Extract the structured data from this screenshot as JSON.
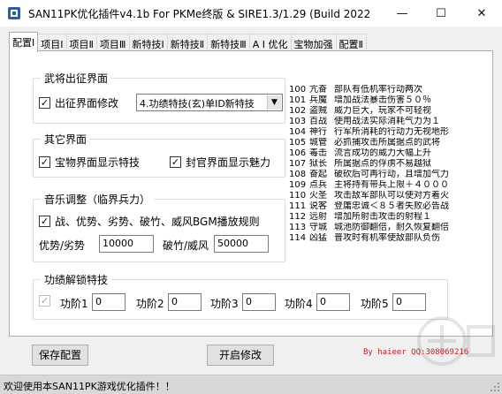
{
  "window": {
    "title": "SAN11PK优化插件v4.1b  For PKMe终版 & SIRE1.3/1.29  (Build 2022...",
    "minimize_glyph": "—",
    "maximize_glyph": "☐",
    "close_glyph": "✕"
  },
  "tabs": [
    "配置Ⅰ",
    "项目Ⅰ",
    "项目Ⅱ",
    "项目Ⅲ",
    "新特技Ⅰ",
    "新特技Ⅱ",
    "新特技Ⅲ",
    "A I 优化",
    "宝物加强",
    "配置Ⅱ"
  ],
  "groups": {
    "expedition": {
      "title": "武将出征界面",
      "checkbox_label": "出征界面修改",
      "checked": true,
      "select_value": "4.功绩特技(玄)单ID新特技"
    },
    "other": {
      "title": "其它界面",
      "treasure_label": "宝物界面显示特技",
      "treasure_checked": true,
      "rank_label": "封官界面显示魅力",
      "rank_checked": true
    },
    "music": {
      "title": "音乐调整（临界兵力）",
      "bgm_label": "战、优势、劣势、破竹、威风BGM播放规则",
      "bgm_checked": true,
      "adv_label": "优势/劣势",
      "adv_value": "10000",
      "break_label": "破竹/威风",
      "break_value": "50000"
    },
    "merit": {
      "title": "功绩解锁特技",
      "checked": true,
      "disabled": true,
      "stages": [
        {
          "label": "功阶1",
          "value": "0"
        },
        {
          "label": "功阶2",
          "value": "0"
        },
        {
          "label": "功阶3",
          "value": "0"
        },
        {
          "label": "功阶4",
          "value": "0"
        },
        {
          "label": "功阶5",
          "value": "0"
        }
      ]
    }
  },
  "traits": [
    {
      "num": "100",
      "name": "亢奋",
      "desc": "部队有低机率行动两次"
    },
    {
      "num": "101",
      "name": "兵魔",
      "desc": "增加战法暴击伤害５０％"
    },
    {
      "num": "102",
      "name": "盗贼",
      "desc": "威力巨大，玩家不可轻视"
    },
    {
      "num": "103",
      "name": "百战",
      "desc": "使用战法实际消耗气力为１"
    },
    {
      "num": "104",
      "name": "神行",
      "desc": "行军所消耗的行动力无视地形"
    },
    {
      "num": "105",
      "name": "城管",
      "desc": "必抓捕攻击所属据点的武将"
    },
    {
      "num": "106",
      "name": "毒击",
      "desc": "流言成功的威力大幅上升"
    },
    {
      "num": "107",
      "name": "狱长",
      "desc": "所属据点的俘虏不易越狱"
    },
    {
      "num": "108",
      "name": "奋起",
      "desc": "破砍后可再行动，且增加气力"
    },
    {
      "num": "109",
      "name": "点兵",
      "desc": "主将持有带兵上限＋４０００"
    },
    {
      "num": "110",
      "name": "火圣",
      "desc": "攻击敌军部队可以使对方着火"
    },
    {
      "num": "111",
      "name": "说客",
      "desc": "登庸忠诚＜８５者失败必告战"
    },
    {
      "num": "112",
      "name": "远射",
      "desc": "增加所射击攻击的射程１"
    },
    {
      "num": "113",
      "name": "守城",
      "desc": "城池防御翻倍，耐久恢复翻倍"
    },
    {
      "num": "114",
      "name": "凶猛",
      "desc": "普攻时有机率使敌部队负伤"
    }
  ],
  "credit": "By haieer   QQ:308069216",
  "buttons": {
    "save": "保存配置",
    "apply": "开启修改"
  },
  "status": "欢迎使用本SAN11PK游戏优化插件！！",
  "colors": {
    "credit": "#c31d26",
    "window_bg": "#f0f0f0",
    "panel_bg": "#ffffff"
  },
  "icons": {
    "app": "app-logo-icon",
    "select": "chevron-down-icon",
    "grip": "resize-grip-icon"
  }
}
